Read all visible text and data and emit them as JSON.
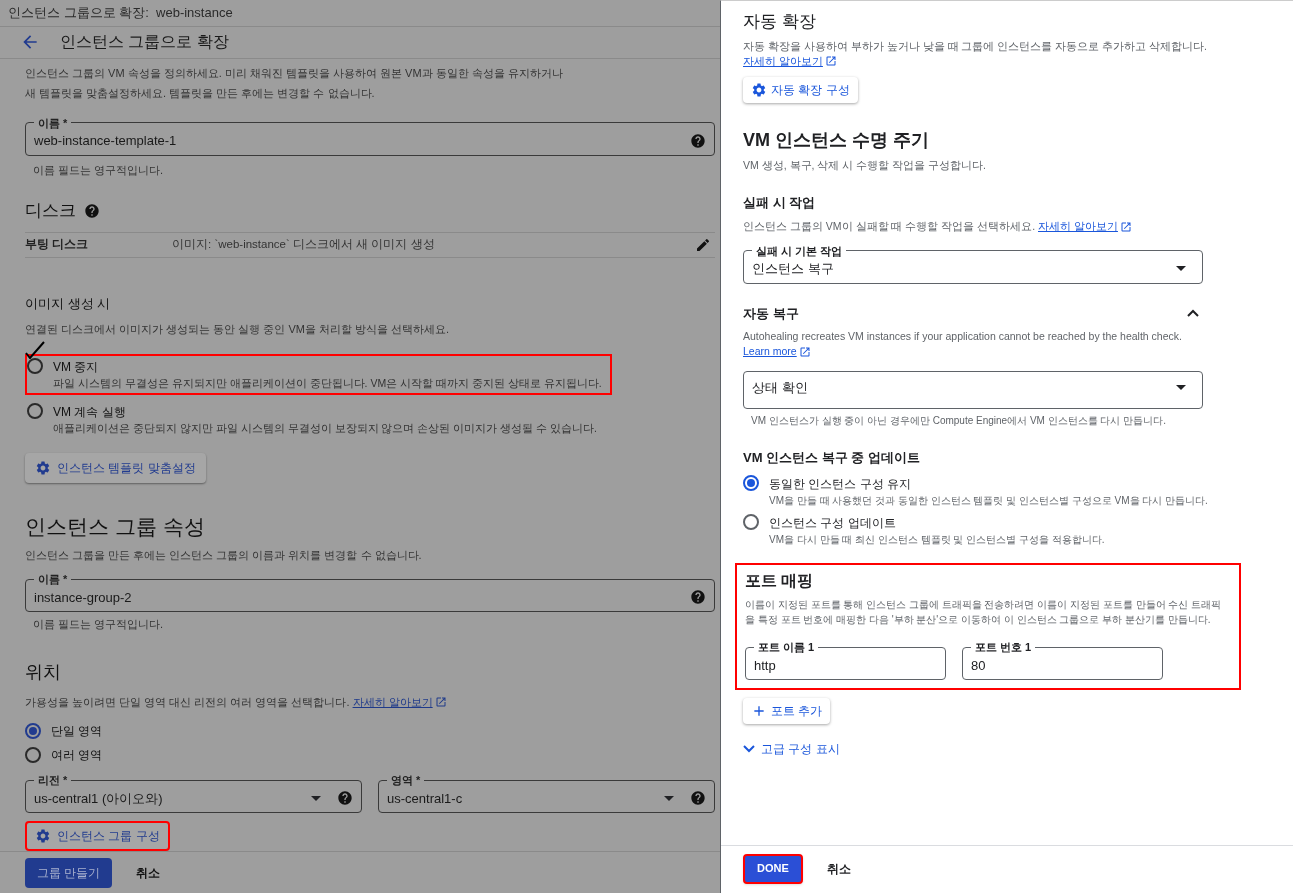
{
  "left_panel": {
    "window_title": "인스턴스 그룹으로 확장:  web-instance",
    "page_title": "인스턴스 그룹으로 확장",
    "intro": "인스턴스 그룹의 VM 속성을 정의하세요. 미리 채워진 템플릿을 사용하여 원본 VM과 동일한 속성을 유지하거나 새 템플릿을 맞춤설정하세요. 템플릿을 만든 후에는 변경할 수 없습니다.",
    "template_name": {
      "label": "이름 *",
      "value": "web-instance-template-1",
      "helper": "이름 필드는 영구적입니다."
    },
    "disk": {
      "heading": "디스크",
      "row_label": "부팅 디스크",
      "row_value": "이미지: `web-instance` 디스크에서 새 이미지 생성"
    },
    "image_creation": {
      "heading": "이미지 생성 시",
      "description": "연결된 디스크에서 이미지가 생성되는 동안 실행 중인 VM을 처리할 방식을 선택하세요.",
      "options": [
        {
          "label": "VM 중지",
          "description": "파일 시스템의 무결성은 유지되지만 애플리케이션이 중단됩니다. VM은 시작할 때까지 중지된 상태로 유지됩니다.",
          "selected": false,
          "highlighted": true,
          "ticked": true
        },
        {
          "label": "VM 계속 실행",
          "description": "애플리케이션은 중단되지 않지만 파일 시스템의 무결성이 보장되지 않으며 손상된 이미지가 생성될 수 있습니다.",
          "selected": false,
          "highlighted": false,
          "ticked": false
        }
      ],
      "button": {
        "label": "인스턴스 템플릿 맞춤설정",
        "highlighted": false
      }
    },
    "group_properties": {
      "heading": "인스턴스 그룹 속성",
      "description": "인스턴스 그룹을 만든 후에는 인스턴스 그룹의 이름과 위치를 변경할 수 없습니다.",
      "name": {
        "label": "이름 *",
        "value": "instance-group-2",
        "helper": "이름 필드는 영구적입니다."
      }
    },
    "location": {
      "heading": "위치",
      "description": "가용성을 높이려면 단일 영역 대신 리전의 여러 영역을 선택합니다.",
      "link": "자세히 알아보기",
      "options": [
        {
          "label": "단일 영역",
          "selected": true
        },
        {
          "label": "여러 영역",
          "selected": false
        }
      ],
      "region": {
        "label": "리전 *",
        "value": "us-central1 (아이오와)"
      },
      "zone": {
        "label": "영역 *",
        "value": "us-central1-c"
      },
      "button": {
        "label": "인스턴스 그룹 구성",
        "highlighted": true
      }
    },
    "footer": {
      "primary": "그룹 만들기",
      "cancel": "취소"
    }
  },
  "right_panel": {
    "autoscaling": {
      "heading": "자동 확장",
      "description": "자동 확장을 사용하여 부하가 높거나 낮을 때 그룹에 인스턴스를 자동으로 추가하고 삭제합니다.",
      "link": "자세히 알아보기",
      "button": "자동 확장 구성"
    },
    "lifecycle": {
      "heading": "VM 인스턴스 수명 주기",
      "description": "VM 생성, 복구, 삭제 시 수행할 작업을 구성합니다.",
      "failure": {
        "heading": "실패 시 작업",
        "description": "인스턴스 그룹의 VM이 실패할 때 수행할 작업을 선택하세요.",
        "link": "자세히 알아보기",
        "select_label": "실패 시 기본 작업",
        "select_value": "인스턴스 복구"
      }
    },
    "autohealing": {
      "heading": "자동 복구",
      "expanded": true,
      "description": "Autohealing recreates VM instances if your application cannot be reached by the health check.",
      "link": "Learn more",
      "select_value": "상태 확인",
      "helper": "VM 인스턴스가 실행 중이 아닌 경우에만 Compute Engine에서 VM 인스턴스를 다시 만듭니다."
    },
    "update_on_repair": {
      "heading": "VM 인스턴스 복구 중 업데이트",
      "options": [
        {
          "label": "동일한 인스턴스 구성 유지",
          "description": "VM을 만들 때 사용했던 것과 동일한 인스턴스 템플릿 및 인스턴스별 구성으로 VM을 다시 만듭니다.",
          "selected": true
        },
        {
          "label": "인스턴스 구성 업데이트",
          "description": "VM을 다시 만들 때 최신 인스턴스 템플릿 및 인스턴스별 구성을 적용합니다.",
          "selected": false
        }
      ]
    },
    "port_mapping": {
      "heading": "포트 매핑",
      "highlighted": true,
      "description": "이름이 지정된 포트를 통해 인스턴스 그룹에 트래픽을 전송하려면 이름이 지정된 포트를 만들어 수신 트래픽을 특정 포트 번호에 매핑한 다음 '부하 분산'으로 이동하여 이 인스턴스 그룹으로 부하 분산기를 만듭니다.",
      "fields": [
        {
          "label": "포트 이름 1",
          "value": "http"
        },
        {
          "label": "포트 번호 1",
          "value": "80"
        }
      ],
      "add_button": "포트 추가"
    },
    "advanced": {
      "label": "고급 구성 표시",
      "expanded": false
    },
    "footer": {
      "done": "DONE",
      "done_highlighted": true,
      "cancel": "취소"
    }
  }
}
